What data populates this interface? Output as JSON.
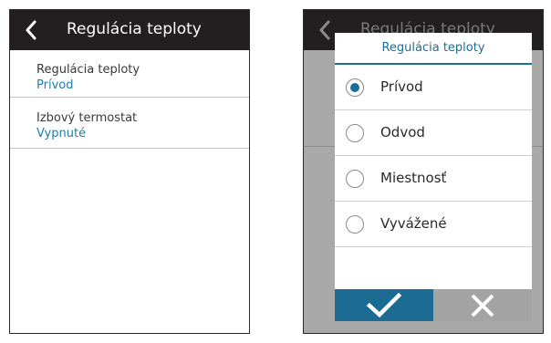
{
  "left_screen": {
    "header": {
      "title": "Regulácia teploty",
      "back_icon": "chevron-left-icon"
    },
    "items": [
      {
        "label": "Regulácia teploty",
        "value": "Prívod"
      },
      {
        "label": "Izbový termostat",
        "value": "Vypnuté"
      }
    ]
  },
  "right_screen": {
    "header": {
      "title": "Regulácia teploty",
      "back_icon": "chevron-left-icon"
    },
    "dialog": {
      "title": "Regulácia teploty",
      "selected_index": 0,
      "options": [
        {
          "label": "Prívod",
          "selected": true
        },
        {
          "label": "Odvod",
          "selected": false
        },
        {
          "label": "Miestnosť",
          "selected": false
        },
        {
          "label": "Vyvážené",
          "selected": false
        }
      ],
      "confirm_icon": "checkmark-icon",
      "cancel_icon": "close-icon"
    }
  },
  "colors": {
    "header_bg": "#231f20",
    "accent_blue": "#1b6e95",
    "value_blue": "#1b7fa6",
    "overlay_gray": "#a9a9a9",
    "cancel_gray": "#a3a3a3"
  }
}
